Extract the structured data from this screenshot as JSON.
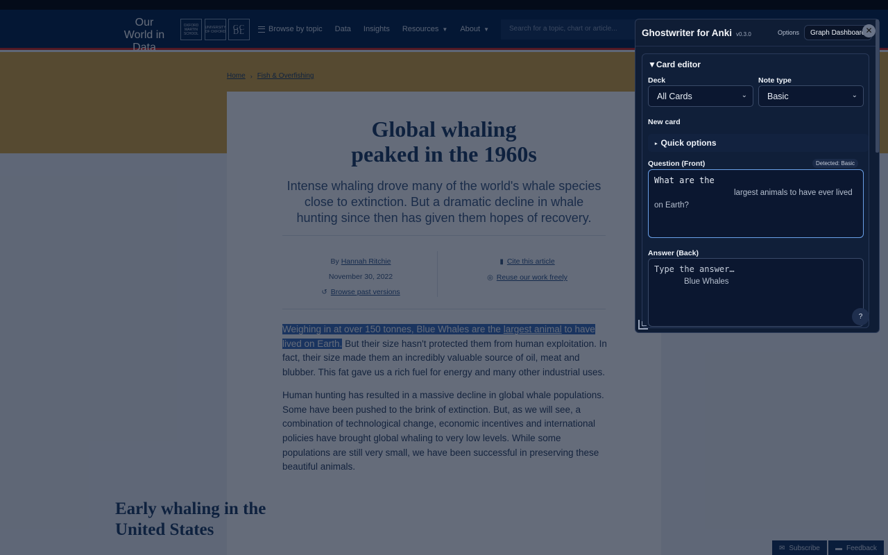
{
  "site": {
    "logo": "Our World in Data",
    "partners": [
      "OXFORD MARTIN SCHOOL",
      "UNIVERSITY OF OXFORD",
      "GC DL"
    ],
    "nav": {
      "browse": "Browse by topic",
      "data": "Data",
      "insights": "Insights",
      "resources": "Resources",
      "about": "About"
    },
    "search_placeholder": "Search for a topic, chart or article..."
  },
  "breadcrumb": {
    "home": "Home",
    "section": "Fish & Overfishing"
  },
  "article": {
    "title_line1": "Global whaling",
    "title_line2": "peaked in the 1960s",
    "subtitle": "Intense whaling drove many of the world's whale species close to extinction. But a dramatic decline in whale hunting since then has given them hopes of recovery.",
    "by_prefix": "By",
    "author": "Hannah Ritchie",
    "date": "November 30, 2022",
    "past_versions": "Browse past versions",
    "cite": "Cite this article",
    "reuse": "Reuse our work freely",
    "p1_hl_a": "Weighing in at over 150 tonnes, Blue Whales are the ",
    "p1_hl_link": "largest animal",
    "p1_hl_b": " to have lived on Earth.",
    "p1_rest": " But their size hasn't protected them from human exploitation. In fact, their size made them an incredibly valuable source of oil, meat and blubber. This fat gave us a rich fuel for energy and many other industrial uses.",
    "p2": "Human hunting has resulted in a massive decline in global whale populations. Some have been pushed to the brink of extinction. But, as we will see, a combination of technological change, economic incentives and international policies have brought global whaling to very low levels. While some populations are still very small, we have been successful in preserving these beautiful animals.",
    "section_heading": "Early whaling in the United States"
  },
  "footer_buttons": {
    "subscribe": "Subscribe",
    "feedback": "Feedback"
  },
  "ghostwriter": {
    "title": "Ghostwriter for Anki",
    "version": "v0.3.0",
    "options": "Options",
    "dashboard": "Graph Dashboard",
    "card_editor": "Card editor",
    "deck_label": "Deck",
    "deck_value": "All Cards",
    "note_type_label": "Note type",
    "note_type_value": "Basic",
    "new_card": "New card",
    "quick_options": "Quick options",
    "question_label": "Question (Front)",
    "detected": "Detected: Basic",
    "question_typed": "What are the",
    "question_ghost_1": "largest animals to have ever lived",
    "question_ghost_2": "on Earth?",
    "answer_label": "Answer (Back)",
    "answer_placeholder": "Type the answer…",
    "answer_ghost": "Blue Whales",
    "help": "?"
  }
}
